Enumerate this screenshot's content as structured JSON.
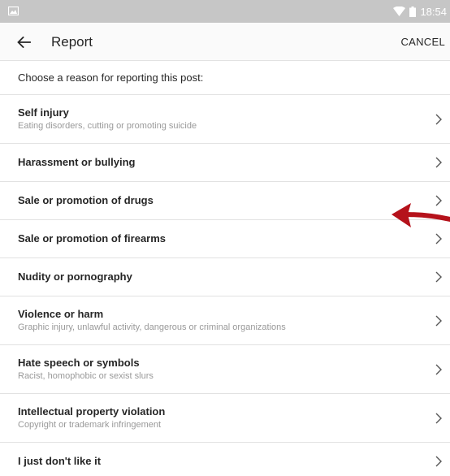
{
  "status_bar": {
    "time": "18:54",
    "icons": [
      "image-icon",
      "wifi-icon",
      "battery-icon"
    ]
  },
  "app_bar": {
    "title": "Report",
    "cancel_label": "CANCEL",
    "back_icon": "back-arrow-icon"
  },
  "prompt": "Choose a reason for reporting this post:",
  "reasons": [
    {
      "label": "Self injury",
      "sub": "Eating disorders, cutting or promoting suicide"
    },
    {
      "label": "Harassment or bullying",
      "sub": ""
    },
    {
      "label": "Sale or promotion of drugs",
      "sub": ""
    },
    {
      "label": "Sale or promotion of firearms",
      "sub": ""
    },
    {
      "label": "Nudity or pornography",
      "sub": ""
    },
    {
      "label": "Violence or harm",
      "sub": "Graphic injury, unlawful activity, dangerous or criminal organizations"
    },
    {
      "label": "Hate speech or symbols",
      "sub": "Racist, homophobic or sexist slurs"
    },
    {
      "label": "Intellectual property violation",
      "sub": "Copyright or trademark infringement"
    },
    {
      "label": "I just don't like it",
      "sub": ""
    }
  ],
  "colors": {
    "status_bar": "#c6c6c6",
    "app_bar": "#fafafa",
    "divider": "#e2e2e2",
    "annotation_arrow": "#b5121b"
  }
}
